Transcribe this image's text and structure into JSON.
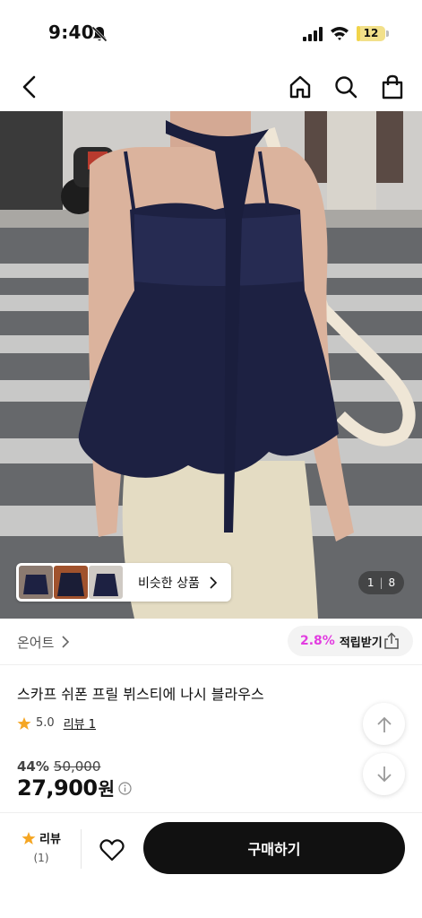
{
  "status_bar": {
    "time": "9:40",
    "battery": "12",
    "battery_level": 0.12
  },
  "header": {
    "back_icon": "chevron-left-icon",
    "home_icon": "home-icon",
    "search_icon": "search-icon",
    "bag_icon": "shopping-bag-icon"
  },
  "gallery": {
    "similar_label": "비슷한 상품",
    "page_current": "1",
    "page_total": "8"
  },
  "brand": {
    "name": "온어트"
  },
  "reward": {
    "rate": "2.8%",
    "label": "적립받기"
  },
  "product": {
    "title": "스카프 쉬폰 프릴 뷔스티에 나시 블라우스",
    "rating": "5.0",
    "review_link": "리뷰 1",
    "discount_rate": "44%",
    "original_price": "50,000",
    "sale_price": "27,900",
    "currency": "원"
  },
  "bottom_bar": {
    "review_label": "리뷰",
    "review_count": "(1)",
    "buy_label": "구매하기"
  },
  "colors": {
    "accent_pink": "#e23de0",
    "star": "#f5a623",
    "buy_button": "#111111"
  }
}
